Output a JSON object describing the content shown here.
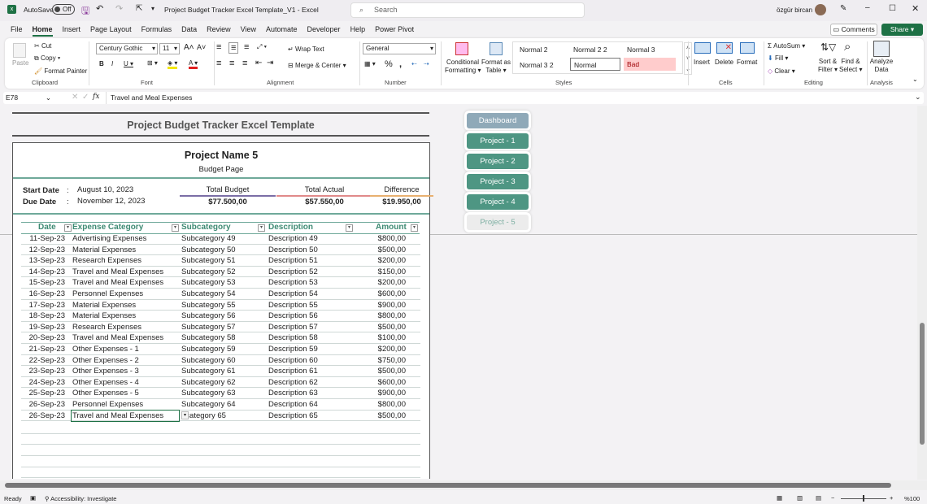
{
  "titlebar": {
    "autosave": "AutoSave",
    "toggle": "Off",
    "doc_title": "Project Budget Tracker Excel Template_V1  -  Excel",
    "search": "Search",
    "user": "özgür bircan"
  },
  "menu": [
    "File",
    "Home",
    "Insert",
    "Page Layout",
    "Formulas",
    "Data",
    "Review",
    "View",
    "Automate",
    "Developer",
    "Help",
    "Power Pivot"
  ],
  "comments": "Comments",
  "share": "Share",
  "ribbon": {
    "paste": "Paste",
    "cut": "Cut",
    "copy": "Copy",
    "format_painter": "Format Painter",
    "clipboard": "Clipboard",
    "font_name": "Century Gothic",
    "font_size": "11",
    "font": "Font",
    "wrap_text": "Wrap Text",
    "merge_center": "Merge & Center",
    "alignment": "Alignment",
    "number_format": "General",
    "number": "Number",
    "conditional": "Conditional",
    "formatting": "Formatting",
    "format_as": "Format as",
    "table": "Table",
    "styles_cells": [
      "Normal 2",
      "Normal 2 2",
      "Normal 3",
      "Normal 3 2",
      "Normal",
      "Bad"
    ],
    "styles": "Styles",
    "insert": "Insert",
    "delete": "Delete",
    "format": "Format",
    "cells": "Cells",
    "autosum": "AutoSum",
    "fill": "Fill",
    "clear": "Clear",
    "sort": "Sort &",
    "filter": "Filter",
    "find": "Find &",
    "select": "Select",
    "editing": "Editing",
    "analyze": "Analyze",
    "data": "Data",
    "analysis": "Analysis"
  },
  "formula": {
    "cell_ref": "E78",
    "fx": "fx",
    "value": "Travel and Meal Expenses"
  },
  "sheet": {
    "title": "Project Budget Tracker Excel Template",
    "project_name": "Project Name 5",
    "subtitle": "Budget Page",
    "start_label": "Start Date",
    "start_value": "August 10, 2023",
    "due_label": "Due Date",
    "due_value": "November 12, 2023",
    "colon": ":",
    "totals": [
      {
        "label": "Total Budget",
        "value": "$77.500,00",
        "color": "#7b6ea6"
      },
      {
        "label": "Total Actual",
        "value": "$57.550,00",
        "color": "#e08a8a"
      },
      {
        "label": "Difference",
        "value": "$19.950,00",
        "color": "#e8b070"
      }
    ],
    "headers": [
      "Date",
      "Expense Category",
      "Subcategory",
      "Description",
      "Amount"
    ],
    "rows": [
      [
        "11-Sep-23",
        "Advertising Expenses",
        "Subcategory 49",
        "Description 49",
        "$800,00"
      ],
      [
        "12-Sep-23",
        "Material Expenses",
        "Subcategory 50",
        "Description 50",
        "$500,00"
      ],
      [
        "13-Sep-23",
        "Research Expenses",
        "Subcategory 51",
        "Description 51",
        "$200,00"
      ],
      [
        "14-Sep-23",
        "Travel and Meal Expenses",
        "Subcategory 52",
        "Description 52",
        "$150,00"
      ],
      [
        "15-Sep-23",
        "Travel and Meal Expenses",
        "Subcategory 53",
        "Description 53",
        "$200,00"
      ],
      [
        "16-Sep-23",
        "Personnel Expenses",
        "Subcategory 54",
        "Description 54",
        "$600,00"
      ],
      [
        "17-Sep-23",
        "Material Expenses",
        "Subcategory 55",
        "Description 55",
        "$900,00"
      ],
      [
        "18-Sep-23",
        "Material Expenses",
        "Subcategory 56",
        "Description 56",
        "$800,00"
      ],
      [
        "19-Sep-23",
        "Research Expenses",
        "Subcategory 57",
        "Description 57",
        "$500,00"
      ],
      [
        "20-Sep-23",
        "Travel and Meal Expenses",
        "Subcategory 58",
        "Description 58",
        "$100,00"
      ],
      [
        "21-Sep-23",
        "Other Expenses - 1",
        "Subcategory 59",
        "Description 59",
        "$200,00"
      ],
      [
        "22-Sep-23",
        "Other Expenses - 2",
        "Subcategory 60",
        "Description 60",
        "$750,00"
      ],
      [
        "23-Sep-23",
        "Other Expenses - 3",
        "Subcategory 61",
        "Description 61",
        "$500,00"
      ],
      [
        "24-Sep-23",
        "Other Expenses - 4",
        "Subcategory 62",
        "Description 62",
        "$600,00"
      ],
      [
        "25-Sep-23",
        "Other Expenses - 5",
        "Subcategory 63",
        "Description 63",
        "$900,00"
      ],
      [
        "26-Sep-23",
        "Personnel Expenses",
        "Subcategory 64",
        "Description 64",
        "$800,00"
      ],
      [
        "26-Sep-23",
        "Travel and Meal Expenses",
        "bcategory 65",
        "Description 65",
        "$500,00"
      ]
    ]
  },
  "nav": [
    {
      "label": "Dashboard",
      "color": "#8fa9b8"
    },
    {
      "label": "Project - 1",
      "color": "#4e9683"
    },
    {
      "label": "Project - 2",
      "color": "#4e9683"
    },
    {
      "label": "Project - 3",
      "color": "#4e9683"
    },
    {
      "label": "Project - 4",
      "color": "#4e9683"
    },
    {
      "label": "Project - 5",
      "color": "#ececec"
    }
  ],
  "status": {
    "ready": "Ready",
    "accessibility": "Accessibility: Investigate",
    "zoom": "%100"
  }
}
